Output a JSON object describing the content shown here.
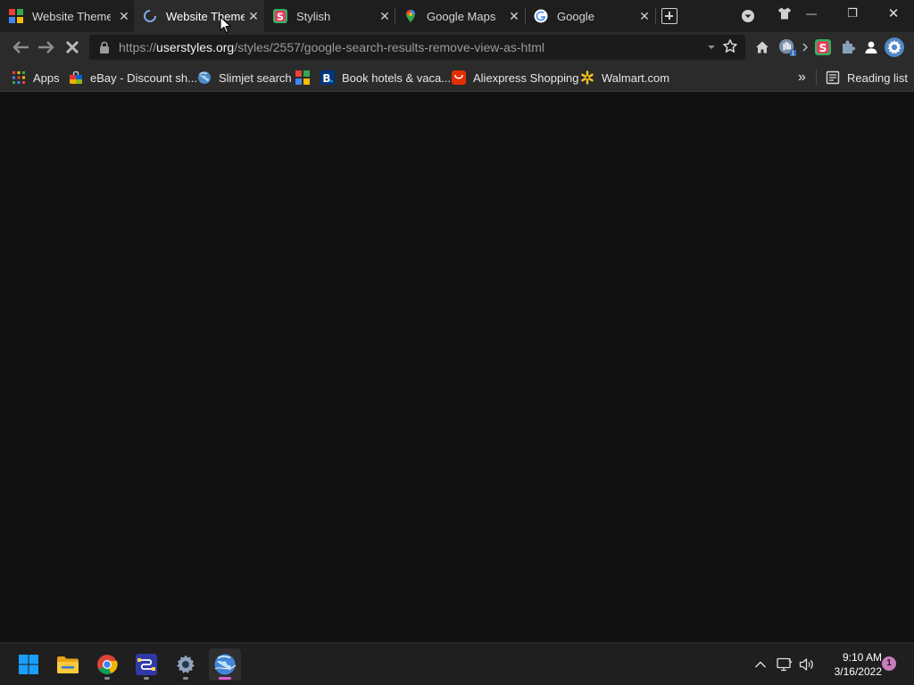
{
  "tabs": [
    {
      "title": "Website Themes",
      "active": false
    },
    {
      "title": "Website Themes",
      "active": true
    },
    {
      "title": "Stylish",
      "active": false
    },
    {
      "title": "Google Maps",
      "active": false
    },
    {
      "title": "Google",
      "active": false
    }
  ],
  "tab_close_glyph": "✕",
  "window_controls": {
    "minimize": "—",
    "restore": "❐",
    "close": "✕"
  },
  "omnibox": {
    "url_prefix": "https://",
    "url_host": "userstyles.org",
    "url_path": "/styles/2557/google-search-results-remove-view-as-html"
  },
  "bookmarks": [
    {
      "label": "Apps",
      "icon": "apps-grid-icon"
    },
    {
      "label": "eBay - Discount sh...",
      "icon": "ebay-icon"
    },
    {
      "label": "Slimjet search",
      "icon": "globe-icon"
    },
    {
      "label": "",
      "icon": "website-themes-icon"
    },
    {
      "label": "Book hotels & vaca...",
      "icon": "booking-icon"
    },
    {
      "label": "Aliexpress Shopping",
      "icon": "aliexpress-icon"
    },
    {
      "label": "Walmart.com",
      "icon": "walmart-icon"
    }
  ],
  "bookmarks_overflow": "»",
  "reading_list": "Reading list",
  "taskbar": {
    "time": "9:10 AM",
    "date": "3/16/2022",
    "notification_count": "1"
  },
  "colors": {
    "accent_pink": "#e05ad0",
    "content_bg": "#111111",
    "chrome_bg": "#2b2b2b"
  }
}
